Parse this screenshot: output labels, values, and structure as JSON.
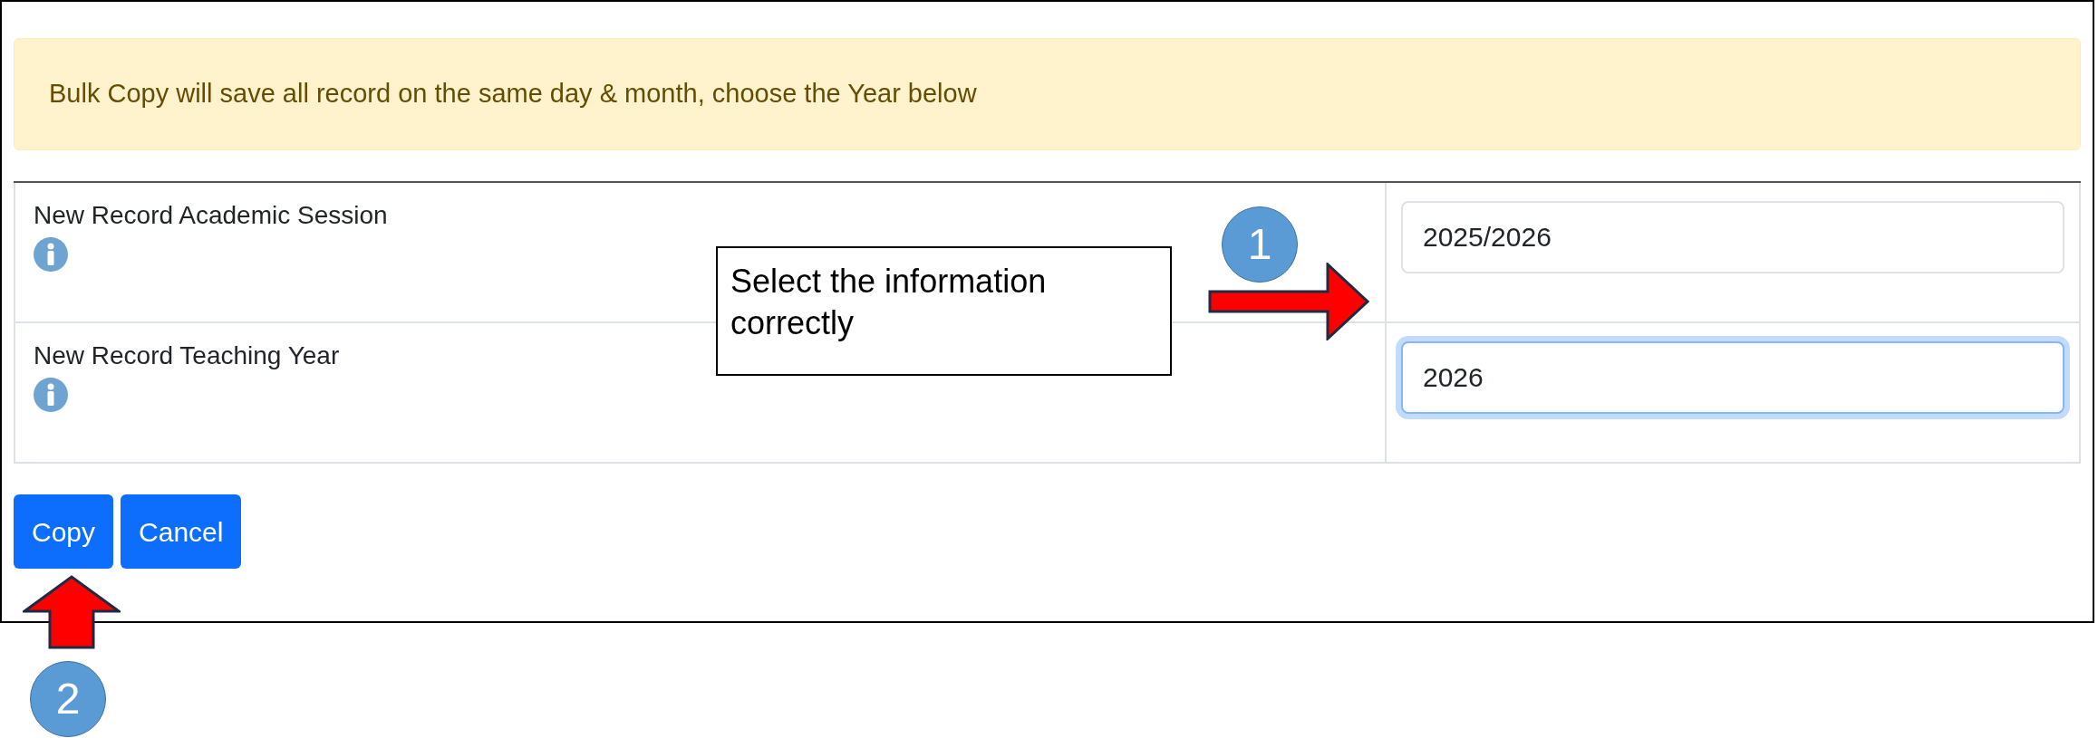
{
  "alert": {
    "text": "Bulk Copy will save all record on the same day & month, choose the Year below"
  },
  "form": {
    "rows": [
      {
        "label": "New Record Academic Session",
        "value": "2025/2026",
        "focused": false
      },
      {
        "label": "New Record Teaching Year",
        "value": "2026",
        "focused": true
      }
    ]
  },
  "buttons": [
    {
      "label": "Copy"
    },
    {
      "label": "Cancel"
    }
  ],
  "annotations": [
    {
      "kind": "callout",
      "text": "Select the information correctly"
    },
    {
      "kind": "step",
      "text": "1"
    },
    {
      "kind": "step",
      "text": "2"
    }
  ]
}
